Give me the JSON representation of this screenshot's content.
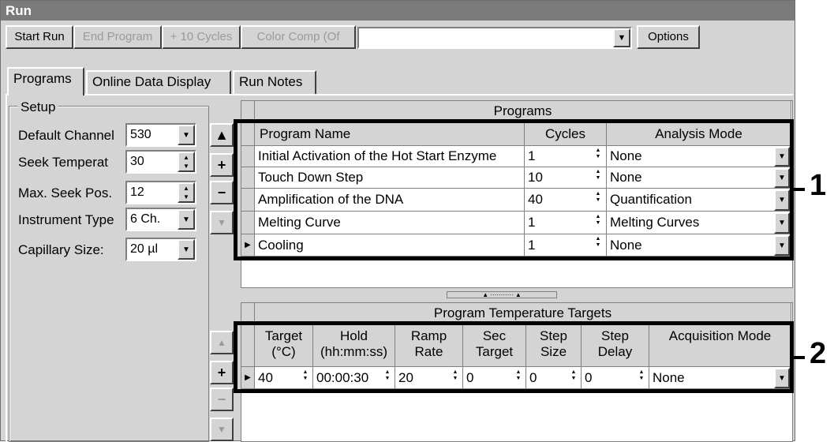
{
  "window": {
    "title": "Run"
  },
  "toolbar": {
    "start_run": "Start Run",
    "end_program": "End Program",
    "plus_10_cycles": "+ 10 Cycles",
    "color_comp": "Color Comp (Of",
    "combo_value": "",
    "options": "Options"
  },
  "tabs": [
    "Programs",
    "Online Data Display",
    "Run Notes"
  ],
  "setup": {
    "group_label": "Setup",
    "fields": [
      {
        "label": "Default Channel",
        "value": "530"
      },
      {
        "label": "Seek Temperat",
        "value": "30"
      },
      {
        "label": "Max. Seek Pos.",
        "value": "12"
      },
      {
        "label": "Instrument Type",
        "value": "6 Ch."
      },
      {
        "label": "Capillary Size:",
        "value": "20 µl"
      }
    ]
  },
  "programs": {
    "title": "Programs",
    "columns": [
      "Program Name",
      "Cycles",
      "Analysis Mode"
    ],
    "rows": [
      {
        "name": "Initial Activation of the Hot Start Enzyme",
        "cycles": "1",
        "mode": "None"
      },
      {
        "name": "Touch Down Step",
        "cycles": "10",
        "mode": "None"
      },
      {
        "name": "Amplification of the DNA",
        "cycles": "40",
        "mode": "Quantification"
      },
      {
        "name": "Melting Curve",
        "cycles": "1",
        "mode": "Melting Curves"
      },
      {
        "name": "Cooling",
        "cycles": "1",
        "mode": "None"
      }
    ]
  },
  "targets": {
    "title": "Program Temperature Targets",
    "columns": [
      {
        "l1": "Target",
        "l2": "(°C)"
      },
      {
        "l1": "Hold",
        "l2": "(hh:mm:ss)"
      },
      {
        "l1": "Ramp",
        "l2": "Rate"
      },
      {
        "l1": "Sec",
        "l2": "Target"
      },
      {
        "l1": "Step",
        "l2": "Size"
      },
      {
        "l1": "Step",
        "l2": "Delay"
      },
      {
        "l1": "Acquisition Mode",
        "l2": ""
      }
    ],
    "row": [
      "40",
      "00:00:30",
      "20",
      "0",
      "0",
      "0",
      "None"
    ]
  },
  "callouts": [
    "1",
    "2"
  ]
}
